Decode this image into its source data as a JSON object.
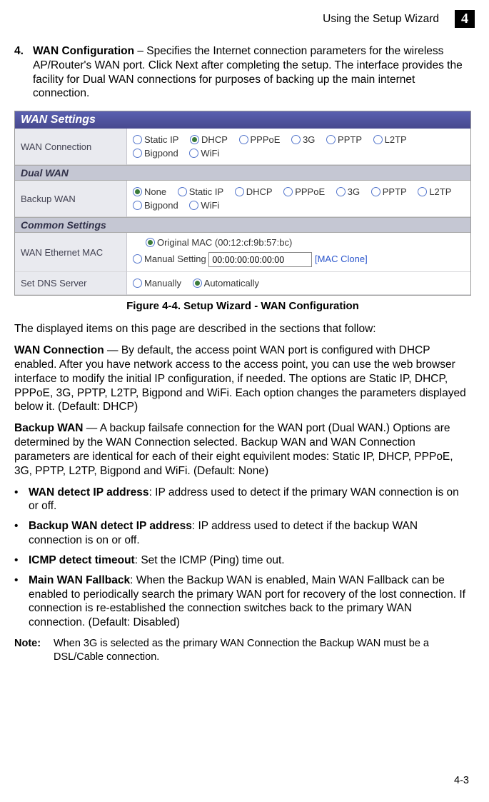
{
  "header": {
    "running": "Using the Setup Wizard",
    "chapter": "4"
  },
  "step": {
    "num": "4.",
    "lead_bold": "WAN Configuration",
    "lead_rest": " – Specifies the Internet connection parameters for the wireless AP/Router's WAN port. Click Next after completing the setup. The interface provides the facility for Dual WAN connections for purposes of backing up the main internet connection."
  },
  "figure": {
    "title_bar": "WAN Settings",
    "row1_label": "WAN Connection",
    "row1_opts": [
      "Static IP",
      "DHCP",
      "PPPoE",
      "3G",
      "PPTP",
      "L2TP",
      "Bigpond",
      "WiFi"
    ],
    "row1_selected": "DHCP",
    "sub1": "Dual WAN",
    "row2_label": "Backup WAN",
    "row2_opts": [
      "None",
      "Static IP",
      "DHCP",
      "PPPoE",
      "3G",
      "PPTP",
      "L2TP",
      "Bigpond",
      "WiFi"
    ],
    "row2_selected": "None",
    "sub2": "Common Settings",
    "row3_label": "WAN Ethernet MAC",
    "row3_opt1": "Original MAC (00:12:cf:9b:57:bc)",
    "row3_opt2": "Manual Setting",
    "row3_mac_value": "00:00:00:00:00:00",
    "row3_link": "[MAC Clone]",
    "row4_label": "Set DNS Server",
    "row4_opts": [
      "Manually",
      "Automatically"
    ],
    "row4_selected": "Automatically",
    "caption": "Figure 4-4.   Setup Wizard - WAN Configuration"
  },
  "para_intro": "The displayed items on this page are described in the sections that follow:",
  "para_wan_bold": "WAN Connection",
  "para_wan": " —  By default, the access point WAN port is configured with DHCP enabled. After you have network access to the access point, you can use the web browser interface to modify the initial IP configuration, if needed. The options are Static IP, DHCP, PPPoE, 3G, PPTP, L2TP, Bigpond and WiFi. Each option changes the parameters displayed below it. (Default: DHCP)",
  "para_bak_bold": "Backup WAN",
  "para_bak": " —  A backup failsafe connection for the WAN port (Dual WAN.) Options are determined by the WAN Connection selected. Backup WAN and WAN Connection parameters are identical for each of their eight equivilent modes: Static IP, DHCP, PPPoE, 3G, PPTP, L2TP, Bigpond and WiFi. (Default: None)",
  "bullets": [
    {
      "b": "WAN detect IP address",
      "t": ":  IP address used to detect if the primary WAN connection is on or off."
    },
    {
      "b": "Backup WAN detect IP address",
      "t": ": IP address used to detect if the backup WAN connection is on or off."
    },
    {
      "b": "ICMP detect timeout",
      "t": ": Set the ICMP (Ping) time out."
    },
    {
      "b": "Main WAN Fallback",
      "t": ": When the Backup WAN is enabled, Main WAN Fallback can be enabled to periodically search the primary WAN port for recovery of the lost connection. If connection is re-established the connection switches back to the primary WAN connection. (Default: Disabled)"
    }
  ],
  "note_label": "Note:",
  "note_text": "When 3G is selected as the primary WAN Connection the Backup WAN must be a DSL/Cable connection.",
  "pagenum": "4-3"
}
